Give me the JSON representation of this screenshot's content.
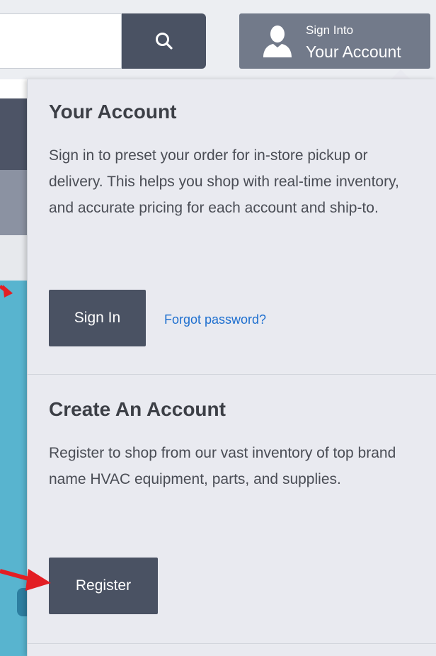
{
  "header": {
    "search": {
      "placeholder": ""
    },
    "account_button": {
      "line1": "Sign Into",
      "line2": "Your Account"
    }
  },
  "panel": {
    "your_account": {
      "title": "Your Account",
      "description": "Sign in to preset your order for in-store pickup or delivery. This helps you shop with real-time inventory, and accurate pricing for each account and ship-to.",
      "sign_in_label": "Sign In",
      "forgot_password_label": "Forgot password?"
    },
    "create_account": {
      "title": "Create An Account",
      "description": "Register to shop from our vast inventory of top brand name HVAC equipment, parts, and supplies.",
      "register_label": "Register"
    }
  },
  "colors": {
    "button_dark": "#4a5263",
    "account_button": "#727a8a",
    "panel_bg": "#e9eaf0",
    "link": "#1e6fcf",
    "annotation_arrow": "#e31e24"
  },
  "icons": {
    "search": "search-icon",
    "account": "user-silhouette-icon"
  }
}
